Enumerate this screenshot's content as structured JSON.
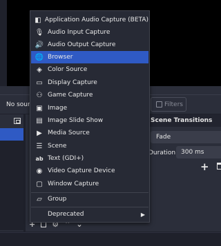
{
  "sources": {
    "empty_text": "No source selected",
    "filters_label": "Filters"
  },
  "transitions": {
    "title": "Scene Transitions",
    "selected": "Fade",
    "duration_label": "Duration",
    "duration_value": "300 ms"
  },
  "toolbar": {
    "add": "+",
    "gear": "⚙",
    "up": "⌃",
    "down": "⌄"
  },
  "menu": {
    "items": [
      {
        "label": "Application Audio Capture (BETA)",
        "icon": "app-audio-icon",
        "glyph": "◧"
      },
      {
        "label": "Audio Input Capture",
        "icon": "microphone-icon",
        "glyph": "🎙"
      },
      {
        "label": "Audio Output Capture",
        "icon": "speaker-icon",
        "glyph": "🔊"
      },
      {
        "label": "Browser",
        "icon": "globe-icon",
        "glyph": "🌐"
      },
      {
        "label": "Color Source",
        "icon": "paint-bucket-icon",
        "glyph": "◈"
      },
      {
        "label": "Display Capture",
        "icon": "monitor-icon",
        "glyph": "▭"
      },
      {
        "label": "Game Capture",
        "icon": "gamepad-icon",
        "glyph": "⚇"
      },
      {
        "label": "Image",
        "icon": "image-icon",
        "glyph": "▣"
      },
      {
        "label": "Image Slide Show",
        "icon": "slideshow-icon",
        "glyph": "▤"
      },
      {
        "label": "Media Source",
        "icon": "play-icon",
        "glyph": "▶"
      },
      {
        "label": "Scene",
        "icon": "list-icon",
        "glyph": "☰"
      },
      {
        "label": "Text (GDI+)",
        "icon": "text-icon",
        "glyph": "ab"
      },
      {
        "label": "Video Capture Device",
        "icon": "camera-icon",
        "glyph": "◉"
      },
      {
        "label": "Window Capture",
        "icon": "window-icon",
        "glyph": "▢"
      },
      {
        "label": "Group",
        "icon": "folder-icon",
        "glyph": "▱"
      },
      {
        "label": "Deprecated",
        "icon": "",
        "glyph": ""
      }
    ],
    "active_index": 3,
    "submenu_arrow": "▶"
  },
  "colors": {
    "accent": "#2f5ac4",
    "background": "#1f212b",
    "panel": "#2b2e3a"
  }
}
